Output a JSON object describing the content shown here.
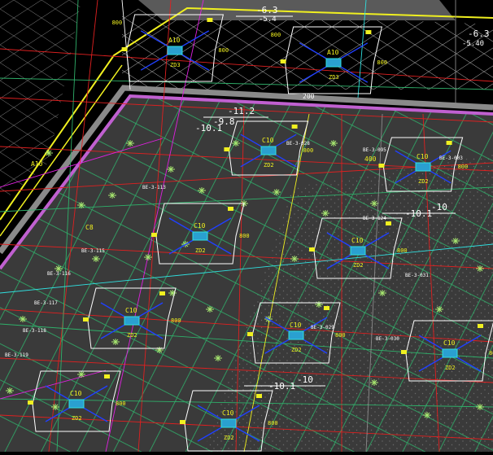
{
  "drawing": {
    "elevations": [
      {
        "id": "elev-top",
        "text": "-6.3"
      },
      {
        "id": "elev-top-right",
        "text": "-6.3"
      },
      {
        "id": "elev-top-sub",
        "text": "-5.4"
      },
      {
        "id": "elev-right-sub",
        "text": "-5.40"
      },
      {
        "id": "elev-mid",
        "text": "-11.2"
      },
      {
        "id": "elev-mid-a",
        "text": "-9.8"
      },
      {
        "id": "elev-mid-b",
        "text": "-10.1"
      },
      {
        "id": "elev-right-a",
        "text": "-10.1"
      },
      {
        "id": "elev-right-b",
        "text": "-10"
      },
      {
        "id": "elev-bottom-a",
        "text": "-10.1"
      },
      {
        "id": "elev-bottom-b",
        "text": "-10"
      }
    ],
    "pile_caps": [
      {
        "id": "cap-a1",
        "type": "A10",
        "code": "ZD3",
        "width": "800",
        "height": "800"
      },
      {
        "id": "cap-a2",
        "type": "A10",
        "code": "ZD3",
        "width": "800",
        "height": "800"
      },
      {
        "id": "cap-c1",
        "type": "C10",
        "code": "ZD2",
        "width": "800"
      },
      {
        "id": "cap-c2",
        "type": "C10",
        "code": "ZD2",
        "width": "800"
      },
      {
        "id": "cap-c3",
        "type": "C10",
        "code": "ZD2",
        "width": "800"
      },
      {
        "id": "cap-c4",
        "type": "C10",
        "code": "ZD2",
        "width": "800"
      },
      {
        "id": "cap-c5",
        "type": "C10",
        "code": "ZD2",
        "width": "800"
      },
      {
        "id": "cap-c6",
        "type": "C10",
        "code": "ZD2",
        "width": "800"
      },
      {
        "id": "cap-c7",
        "type": "C10",
        "code": "ZD2",
        "width": "800"
      },
      {
        "id": "cap-c8",
        "type": "C10",
        "code": "ZD2",
        "width": "800"
      },
      {
        "id": "cap-c9",
        "type": "C10",
        "code": "ZD2",
        "width": "800"
      }
    ],
    "labels": {
      "dim_200": "200",
      "dim_400": "400",
      "side_a10": "A10",
      "side_c8": "C8",
      "tag_a": "BE-3-115",
      "tag_b": "BE-3-116",
      "tag_c": "BE-3-117",
      "tag_d": "BE-3-118",
      "tag_e": "BE-3-119",
      "tag_f": "BE-3-030",
      "tag_g": "BE-3-095",
      "tag_h": "BE-3-031",
      "tag_i": "BE-3-003",
      "tag_j": "BE-3-028",
      "tag_k": "BE-3-029",
      "tag_l": "BE-3-124",
      "tag_m": "BE-3-113"
    },
    "colors": {
      "background": "#000000",
      "pit_fill": "#3a3a3a",
      "pit_edge": "#c060d0",
      "grid_green": "#2fb06a",
      "axis_red": "#e02020",
      "yellow": "#f0f020",
      "blue": "#2040ff",
      "cyan": "#30e0e0",
      "white": "#ffffff",
      "magenta": "#e020e0",
      "gray": "#8a8a8a"
    }
  }
}
